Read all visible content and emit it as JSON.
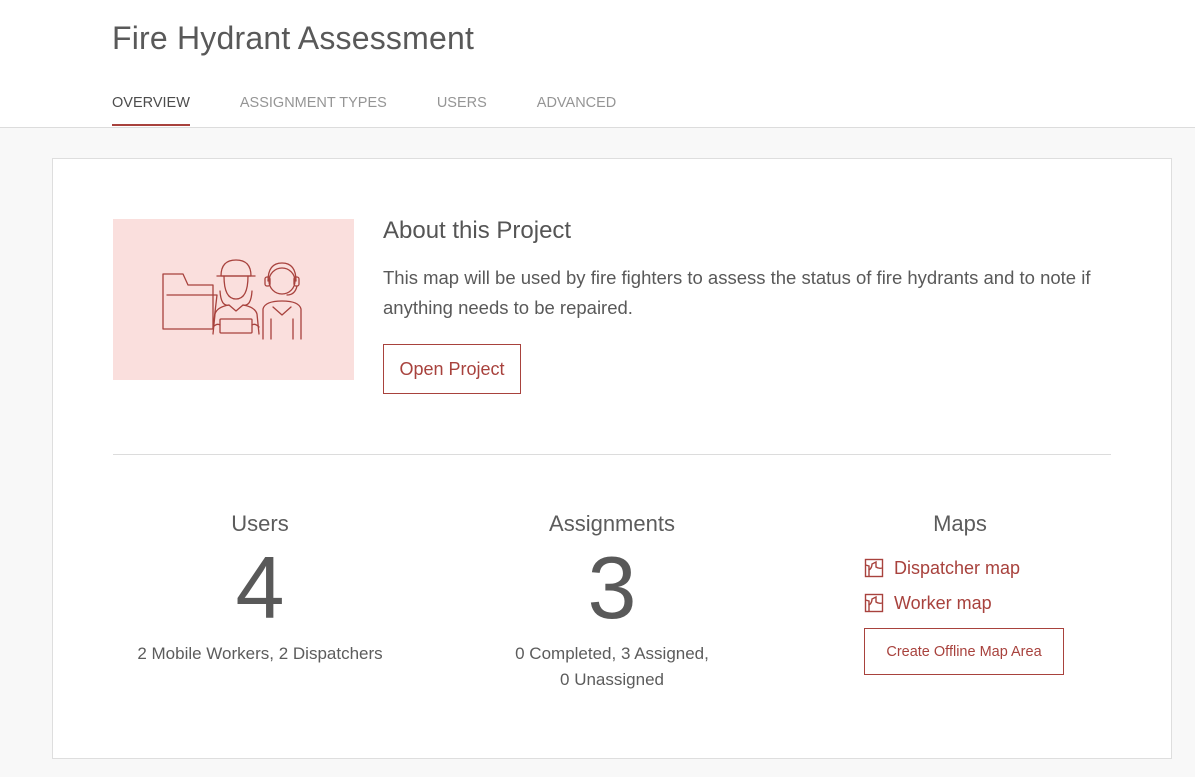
{
  "header": {
    "title": "Fire Hydrant Assessment",
    "tabs": [
      {
        "label": "OVERVIEW",
        "active": true
      },
      {
        "label": "ASSIGNMENT TYPES",
        "active": false
      },
      {
        "label": "USERS",
        "active": false
      },
      {
        "label": "ADVANCED",
        "active": false
      }
    ]
  },
  "about": {
    "title": "About this Project",
    "description": "This map will be used by fire fighters to assess the status of fire hydrants and to note if anything needs to be repaired.",
    "open_button": "Open Project",
    "illustration_icon": "folder-workers-illustration"
  },
  "stats": {
    "users": {
      "label": "Users",
      "value": "4",
      "detail": "2 Mobile Workers, 2 Dispatchers"
    },
    "assignments": {
      "label": "Assignments",
      "value": "3",
      "detail_line1": "0 Completed, 3 Assigned,",
      "detail_line2": "0 Unassigned"
    }
  },
  "maps": {
    "label": "Maps",
    "links": [
      {
        "label": "Dispatcher map",
        "icon": "map-icon"
      },
      {
        "label": "Worker map",
        "icon": "map-icon"
      }
    ],
    "offline_button": "Create Offline Map Area"
  },
  "colors": {
    "accent": "#a8423d",
    "illustration_bg": "#fadfdd",
    "page_bg": "#f8f8f8"
  }
}
